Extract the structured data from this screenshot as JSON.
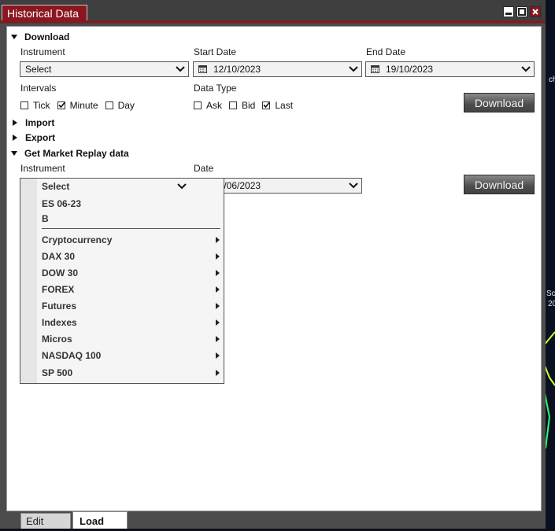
{
  "window": {
    "title": "Historical Data",
    "controls": [
      "minimize-icon",
      "maximize-icon",
      "close-icon"
    ]
  },
  "download_section": {
    "title": "Download",
    "instrument_label": "Instrument",
    "instrument_value": "Select",
    "start_date_label": "Start Date",
    "start_date_value": "12/10/2023",
    "end_date_label": "End Date",
    "end_date_value": "19/10/2023",
    "intervals_label": "Intervals",
    "intervals": [
      {
        "label": "Tick",
        "checked": false
      },
      {
        "label": "Minute",
        "checked": true
      },
      {
        "label": "Day",
        "checked": false
      }
    ],
    "data_type_label": "Data Type",
    "data_types": [
      {
        "label": "Ask",
        "checked": false
      },
      {
        "label": "Bid",
        "checked": false
      },
      {
        "label": "Last",
        "checked": true
      }
    ],
    "button_label": "Download"
  },
  "import_section": {
    "title": "Import"
  },
  "export_section": {
    "title": "Export"
  },
  "replay_section": {
    "title": "Get Market Replay data",
    "instrument_label": "Instrument",
    "instrument_value": "Select",
    "date_label": "Date",
    "date_value": "14/06/2023",
    "button_label": "Download"
  },
  "instrument_dropdown": {
    "selected": "Select",
    "recent": [
      "ES 06-23",
      "B"
    ],
    "groups": [
      "Cryptocurrency",
      "DAX 30",
      "DOW 30",
      "FOREX",
      "Futures",
      "Indexes",
      "Micros",
      "NASDAQ 100",
      "SP 500"
    ]
  },
  "bottom_tabs": {
    "edit": "Edit",
    "load": "Load"
  },
  "desktop": {
    "snippets": [
      "ch",
      "Sc",
      "20"
    ]
  },
  "colors": {
    "title_accent": "#8a1620",
    "window_frame": "#4c4c4c",
    "button_dark": "#4d4d4d"
  }
}
